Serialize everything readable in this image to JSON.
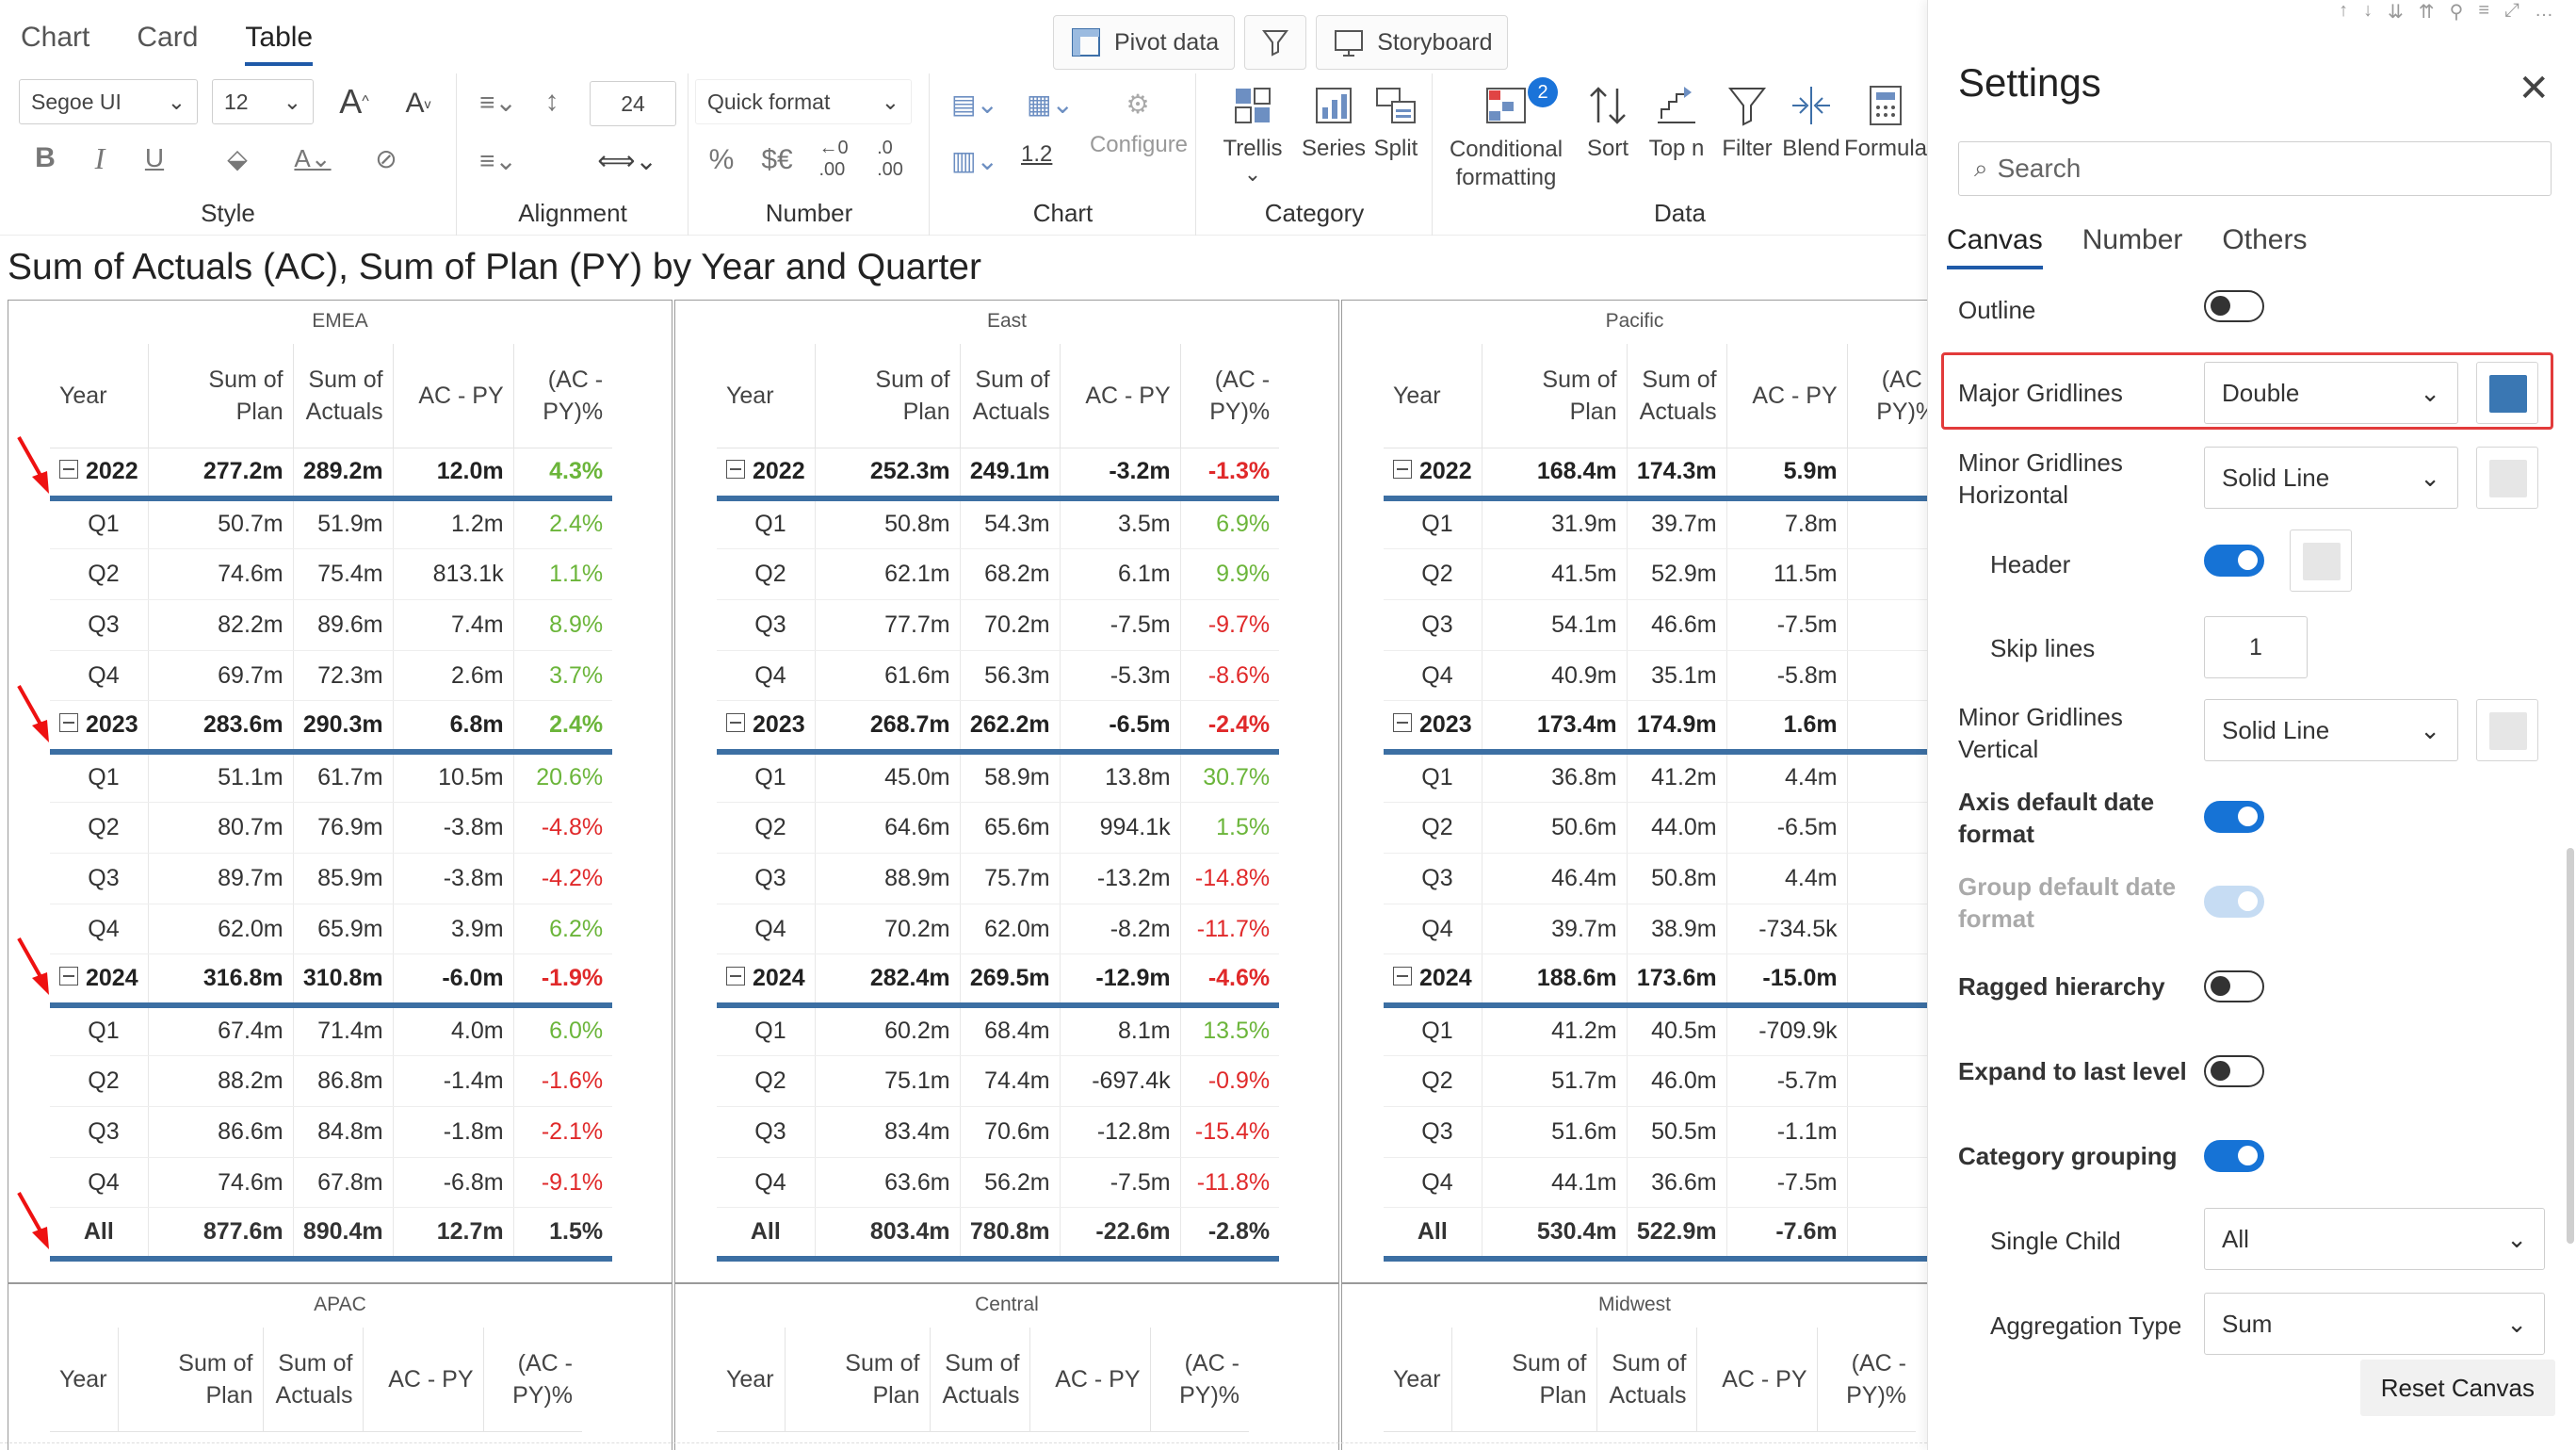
{
  "view_tabs": [
    "Chart",
    "Card",
    "Table"
  ],
  "active_view_tab": "Table",
  "top_buttons": {
    "pivot": "Pivot data",
    "storyboard": "Storyboard"
  },
  "ribbon": {
    "font_family": "Segoe UI",
    "font_size": "12",
    "line_height": "24",
    "quick_format": "Quick format",
    "chart_num": "1.2",
    "configure": "Configure",
    "trellis": "Trellis",
    "series": "Series",
    "split": "Split",
    "cond_format": "Conditional\nformatting",
    "cond_badge": "2",
    "sort": "Sort",
    "topn": "Top n",
    "filter": "Filter",
    "blend": "Blend",
    "formula": "Formula",
    "groups": {
      "style": "Style",
      "alignment": "Alignment",
      "number": "Number",
      "chart": "Chart",
      "category": "Category",
      "data": "Data"
    }
  },
  "chart_title": "Sum of Actuals (AC), Sum of Plan (PY) by Year and Quarter",
  "table_headers": [
    "Year",
    "Sum of Plan",
    "Sum of Actuals",
    "AC - PY",
    "(AC - PY)%"
  ],
  "panels": [
    {
      "region": "EMEA",
      "rows": [
        [
          "2022",
          "277.2m",
          "289.2m",
          "12.0m",
          "4.3%"
        ],
        [
          "Q1",
          "50.7m",
          "51.9m",
          "1.2m",
          "2.4%"
        ],
        [
          "Q2",
          "74.6m",
          "75.4m",
          "813.1k",
          "1.1%"
        ],
        [
          "Q3",
          "82.2m",
          "89.6m",
          "7.4m",
          "8.9%"
        ],
        [
          "Q4",
          "69.7m",
          "72.3m",
          "2.6m",
          "3.7%"
        ],
        [
          "2023",
          "283.6m",
          "290.3m",
          "6.8m",
          "2.4%"
        ],
        [
          "Q1",
          "51.1m",
          "61.7m",
          "10.5m",
          "20.6%"
        ],
        [
          "Q2",
          "80.7m",
          "76.9m",
          "-3.8m",
          "-4.8%"
        ],
        [
          "Q3",
          "89.7m",
          "85.9m",
          "-3.8m",
          "-4.2%"
        ],
        [
          "Q4",
          "62.0m",
          "65.9m",
          "3.9m",
          "6.2%"
        ],
        [
          "2024",
          "316.8m",
          "310.8m",
          "-6.0m",
          "-1.9%"
        ],
        [
          "Q1",
          "67.4m",
          "71.4m",
          "4.0m",
          "6.0%"
        ],
        [
          "Q2",
          "88.2m",
          "86.8m",
          "-1.4m",
          "-1.6%"
        ],
        [
          "Q3",
          "86.6m",
          "84.8m",
          "-1.8m",
          "-2.1%"
        ],
        [
          "Q4",
          "74.6m",
          "67.8m",
          "-6.8m",
          "-9.1%"
        ],
        [
          "All",
          "877.6m",
          "890.4m",
          "12.7m",
          "1.5%"
        ]
      ]
    },
    {
      "region": "East",
      "rows": [
        [
          "2022",
          "252.3m",
          "249.1m",
          "-3.2m",
          "-1.3%"
        ],
        [
          "Q1",
          "50.8m",
          "54.3m",
          "3.5m",
          "6.9%"
        ],
        [
          "Q2",
          "62.1m",
          "68.2m",
          "6.1m",
          "9.9%"
        ],
        [
          "Q3",
          "77.7m",
          "70.2m",
          "-7.5m",
          "-9.7%"
        ],
        [
          "Q4",
          "61.6m",
          "56.3m",
          "-5.3m",
          "-8.6%"
        ],
        [
          "2023",
          "268.7m",
          "262.2m",
          "-6.5m",
          "-2.4%"
        ],
        [
          "Q1",
          "45.0m",
          "58.9m",
          "13.8m",
          "30.7%"
        ],
        [
          "Q2",
          "64.6m",
          "65.6m",
          "994.1k",
          "1.5%"
        ],
        [
          "Q3",
          "88.9m",
          "75.7m",
          "-13.2m",
          "-14.8%"
        ],
        [
          "Q4",
          "70.2m",
          "62.0m",
          "-8.2m",
          "-11.7%"
        ],
        [
          "2024",
          "282.4m",
          "269.5m",
          "-12.9m",
          "-4.6%"
        ],
        [
          "Q1",
          "60.2m",
          "68.4m",
          "8.1m",
          "13.5%"
        ],
        [
          "Q2",
          "75.1m",
          "74.4m",
          "-697.4k",
          "-0.9%"
        ],
        [
          "Q3",
          "83.4m",
          "70.6m",
          "-12.8m",
          "-15.4%"
        ],
        [
          "Q4",
          "63.6m",
          "56.2m",
          "-7.5m",
          "-11.8%"
        ],
        [
          "All",
          "803.4m",
          "780.8m",
          "-22.6m",
          "-2.8%"
        ]
      ]
    },
    {
      "region": "Pacific",
      "rows": [
        [
          "2022",
          "168.4m",
          "174.3m",
          "5.9m",
          ""
        ],
        [
          "Q1",
          "31.9m",
          "39.7m",
          "7.8m",
          ""
        ],
        [
          "Q2",
          "41.5m",
          "52.9m",
          "11.5m",
          ""
        ],
        [
          "Q3",
          "54.1m",
          "46.6m",
          "-7.5m",
          ""
        ],
        [
          "Q4",
          "40.9m",
          "35.1m",
          "-5.8m",
          ""
        ],
        [
          "2023",
          "173.4m",
          "174.9m",
          "1.6m",
          ""
        ],
        [
          "Q1",
          "36.8m",
          "41.2m",
          "4.4m",
          ""
        ],
        [
          "Q2",
          "50.6m",
          "44.0m",
          "-6.5m",
          ""
        ],
        [
          "Q3",
          "46.4m",
          "50.8m",
          "4.4m",
          ""
        ],
        [
          "Q4",
          "39.7m",
          "38.9m",
          "-734.5k",
          ""
        ],
        [
          "2024",
          "188.6m",
          "173.6m",
          "-15.0m",
          ""
        ],
        [
          "Q1",
          "41.2m",
          "40.5m",
          "-709.9k",
          ""
        ],
        [
          "Q2",
          "51.7m",
          "46.0m",
          "-5.7m",
          ""
        ],
        [
          "Q3",
          "51.6m",
          "50.5m",
          "-1.1m",
          ""
        ],
        [
          "Q4",
          "44.1m",
          "36.6m",
          "-7.5m",
          ""
        ],
        [
          "All",
          "530.4m",
          "522.9m",
          "-7.6m",
          ""
        ]
      ]
    }
  ],
  "bottom_panels": [
    "APAC",
    "Central",
    "Midwest"
  ],
  "settings": {
    "title": "Settings",
    "search_placeholder": "Search",
    "tabs": [
      "Canvas",
      "Number",
      "Others"
    ],
    "active_tab": "Canvas",
    "outline": "Outline",
    "major_gridlines": "Major Gridlines",
    "major_gridlines_value": "Double",
    "major_gridlines_color": "#3a77b3",
    "minor_h": "Minor Gridlines\nHorizontal",
    "minor_h_value": "Solid Line",
    "header": "Header",
    "skip_lines": "Skip lines",
    "skip_lines_value": "1",
    "minor_v": "Minor Gridlines\nVertical",
    "minor_v_value": "Solid Line",
    "axis_date": "Axis default date\nformat",
    "group_date": "Group default date\nformat",
    "ragged": "Ragged hierarchy",
    "expand": "Expand to last level",
    "cat_group": "Category grouping",
    "single_child": "Single Child",
    "single_child_value": "All",
    "agg_type": "Aggregation Type",
    "agg_value": "Sum",
    "reset": "Reset Canvas"
  },
  "colors": {
    "accent": "#1673d6",
    "positive": "#6bb53a",
    "negative": "#e0292a",
    "gridline": "#3c6fa3",
    "highlight": "#e23b3b"
  }
}
